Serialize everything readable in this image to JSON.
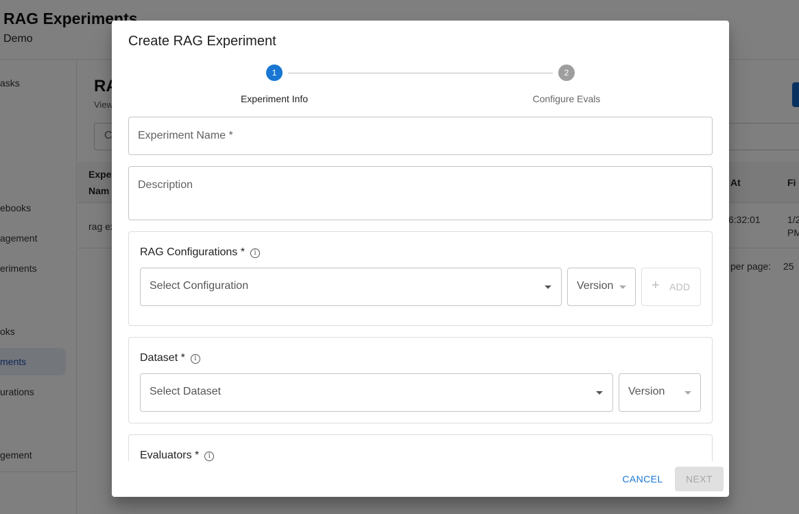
{
  "background": {
    "app_title": "RAG Experiments",
    "app_subtitle": "Demo",
    "sidebar": {
      "items": [
        {
          "label": "asks"
        },
        {
          "label": "ebooks"
        },
        {
          "label": "agement"
        },
        {
          "label": "eriments"
        },
        {
          "label": "oks"
        },
        {
          "label": "ments"
        },
        {
          "label": "urations"
        },
        {
          "label": "gement"
        }
      ]
    },
    "main": {
      "title": "RA",
      "subtitle": "View",
      "search_placeholder": "C",
      "table": {
        "headers": [
          "Expe",
          "Nam",
          "At",
          "Fi"
        ],
        "row": [
          "rag ex",
          "6:32:01",
          "1/2",
          "PM"
        ]
      },
      "pager_label": "per page:",
      "pager_value": "25"
    }
  },
  "dialog": {
    "title": "Create RAG Experiment",
    "stepper": [
      {
        "number": "1",
        "label": "Experiment Info"
      },
      {
        "number": "2",
        "label": "Configure Evals"
      }
    ],
    "fields": {
      "experiment_name": "Experiment Name *",
      "description": "Description"
    },
    "sections": {
      "rag": {
        "title": "RAG Configurations *",
        "config_placeholder": "Select Configuration",
        "version_placeholder": "Version",
        "add_label": "ADD",
        "add_icon": "+"
      },
      "dataset": {
        "title": "Dataset *",
        "dataset_placeholder": "Select Dataset",
        "version_placeholder": "Version"
      },
      "evaluators": {
        "title": "Evaluators *"
      }
    },
    "info_icon_glyph": "i",
    "actions": {
      "cancel": "CANCEL",
      "next": "NEXT"
    }
  },
  "colors": {
    "primary": "#1976d2",
    "step_inactive": "#9e9e9e",
    "backdrop": "rgba(0,0,0,0.5)"
  }
}
